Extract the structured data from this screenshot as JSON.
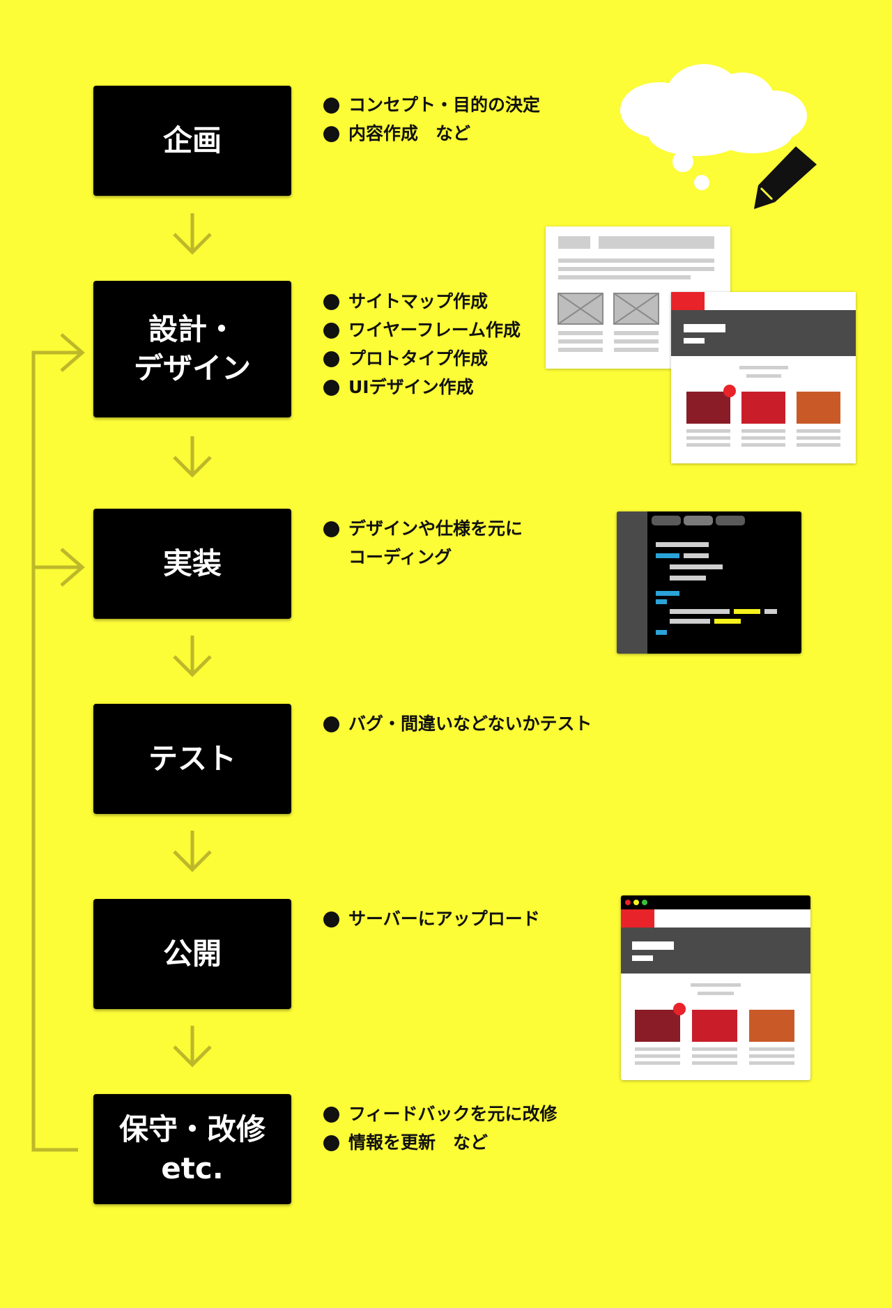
{
  "colors": {
    "background": "#fcfc37",
    "box": "#000000",
    "box_text": "#ffffff",
    "arrow": "#bdb82a",
    "accent_red": "#e8232a",
    "dark_red": "#8a1c27",
    "mid_red": "#c91e2a",
    "orange": "#c95a27",
    "code_blue": "#2aa3d8",
    "code_yellow": "#f6f21c"
  },
  "steps": [
    {
      "lines": [
        "企画"
      ],
      "bullets": [
        "コンセプト・目的の決定",
        "内容作成　など"
      ]
    },
    {
      "lines": [
        "設計・",
        "デザイン"
      ],
      "bullets": [
        "サイトマップ作成",
        "ワイヤーフレーム作成",
        "プロトタイプ作成",
        "UIデザイン作成"
      ]
    },
    {
      "lines": [
        "実装"
      ],
      "bullets": [
        "デザインや仕様を元に"
      ],
      "continuation": "コーディング"
    },
    {
      "lines": [
        "テスト"
      ],
      "bullets": [
        "バグ・間違いなどないかテスト"
      ]
    },
    {
      "lines": [
        "公開"
      ],
      "bullets": [
        "サーバーにアップロード"
      ]
    },
    {
      "lines": [
        "保守・改修",
        "etc."
      ],
      "bullets": [
        "フィードバックを元に改修",
        "情報を更新　など"
      ]
    }
  ],
  "icons": [
    "thought-cloud-icon",
    "pencil-icon",
    "down-arrow-icon",
    "loop-arrow-icon"
  ]
}
